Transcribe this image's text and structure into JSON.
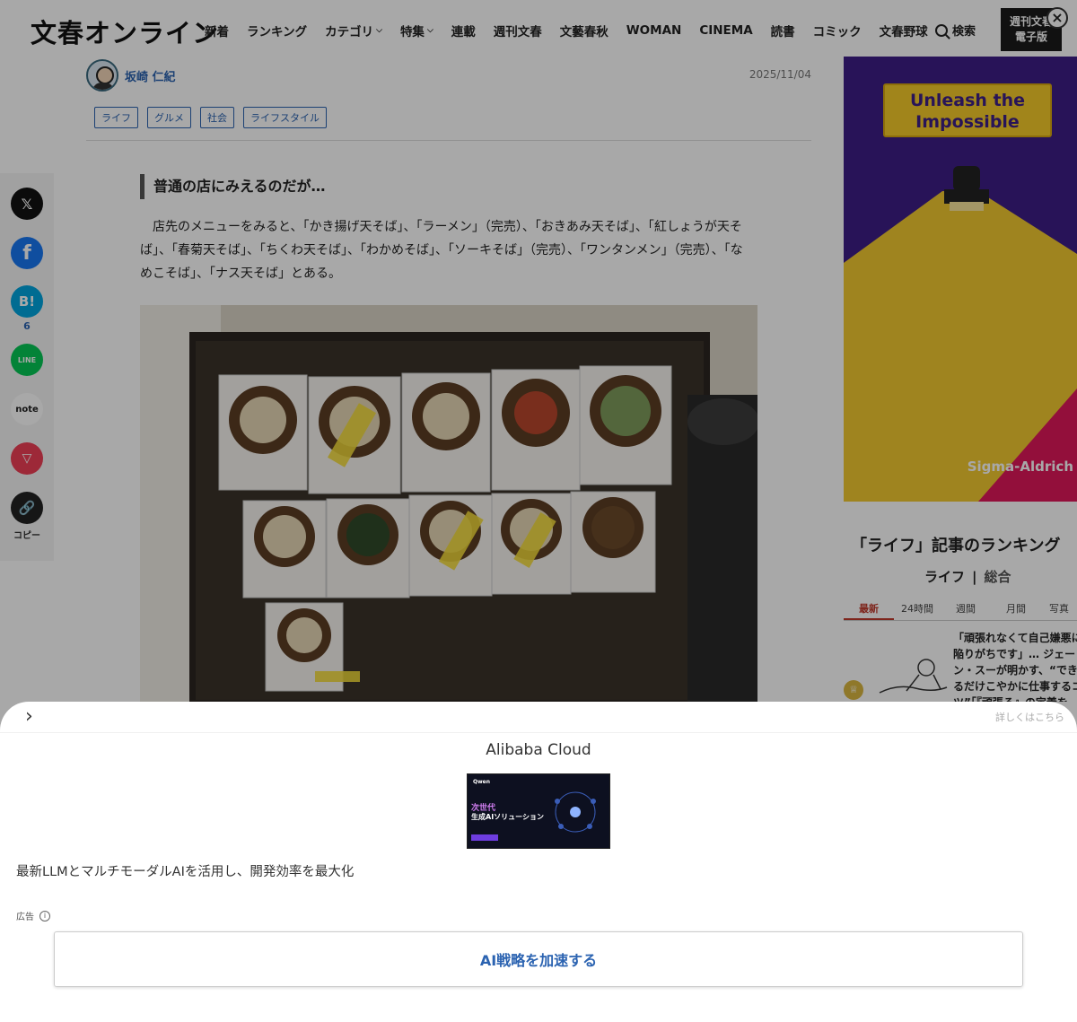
{
  "header": {
    "logo": "文春オンライン",
    "nav": [
      {
        "label": "新着",
        "dropdown": false
      },
      {
        "label": "ランキング",
        "dropdown": false
      },
      {
        "label": "カテゴリ",
        "dropdown": true
      },
      {
        "label": "特集",
        "dropdown": true
      },
      {
        "label": "連載",
        "dropdown": false
      },
      {
        "label": "週刊文春",
        "dropdown": false
      },
      {
        "label": "文藝春秋",
        "dropdown": false
      },
      {
        "label": "WOMAN",
        "dropdown": false
      },
      {
        "label": "CINEMA",
        "dropdown": false
      },
      {
        "label": "読書",
        "dropdown": false
      },
      {
        "label": "コミック",
        "dropdown": false
      },
      {
        "label": "文春野球",
        "dropdown": false
      }
    ],
    "search_label": "検索",
    "ebook_line1": "週刊文春",
    "ebook_line2": "電子版"
  },
  "article": {
    "author": "坂崎 仁紀",
    "date": "2025/11/04",
    "tags": [
      "ライフ",
      "グルメ",
      "社会",
      "ライフスタイル"
    ],
    "heading": "普通の店にみえるのだが…",
    "paragraph": "店先のメニューをみると、「かき揚げ天そば」、「ラーメン」（完売）、「おきあみ天そば」、「紅しょうが天そば」、「春菊天そば」、「ちくわ天そば」、「わかめそば」、「ソーキそば」（完売）、「ワンタンメン」（完売）、「なめこそば」、「ナス天そば」とある。"
  },
  "share": {
    "hatena_count": "6",
    "copy_label": "コピー"
  },
  "sidebar": {
    "ad_headline": "Unleash the Impossible",
    "ad_brand": "Sigma-Aldrich",
    "ranking_title": "「ライフ」記事のランキング",
    "ranking_category": "ライフ",
    "ranking_total": "総合",
    "tabs": [
      "最新",
      "24時間",
      "週間",
      "月間",
      "写真"
    ],
    "active_tab": "最新",
    "top_item": "「頑張れなくて自己嫌悪に陥りがちです」… ジェーン・スーが明かす、“できるだけこやかに仕事するコツ”「『頑張る』の定義を"
  },
  "overlay": {
    "details_link": "詳しくはこちら",
    "advertiser": "Alibaba Cloud",
    "creative_logo": "Qwen",
    "creative_headline": "次世代",
    "creative_subheadline": "生成AIソリューション",
    "description": "最新LLMとマルチモーダルAIを活用し、開発効率を最大化",
    "ad_label": "広告",
    "cta": "AI戦略を加速する"
  },
  "colors": {
    "link_blue": "#2b63b1",
    "ad_yellow": "#f2c830",
    "ad_purple": "#3e1f86",
    "ranking_red": "#c0392b",
    "x_black": "#111111",
    "facebook_blue": "#1877f2",
    "hatena_blue": "#00a4de",
    "line_green": "#06c755",
    "pocket_red": "#ef3f56"
  }
}
